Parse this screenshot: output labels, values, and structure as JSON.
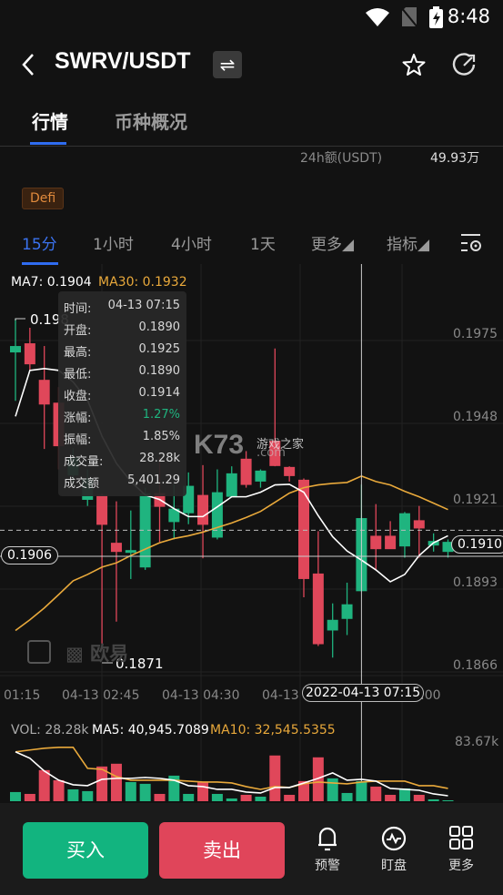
{
  "status": {
    "time": "8:48",
    "icons": [
      "wifi-icon",
      "no-sim-icon",
      "battery-charging-icon"
    ]
  },
  "header": {
    "pair": "SWRV/USDT",
    "back_icon": "chevron-left-icon",
    "swap_icon": "swap-arrows-icon",
    "favorite_icon": "star-icon",
    "share_icon": "refresh-icon"
  },
  "tabs": [
    {
      "label": "行情",
      "active": true
    },
    {
      "label": "币种概况",
      "active": false
    }
  ],
  "stats": {
    "label": "24h额(USDT)",
    "value": "49.93万"
  },
  "tag": "Defi",
  "timeframes": [
    {
      "label": "15分",
      "active": true
    },
    {
      "label": "1小时"
    },
    {
      "label": "4小时"
    },
    {
      "label": "1天"
    },
    {
      "label": "更多◢"
    },
    {
      "label": "指标◢"
    }
  ],
  "colors": {
    "up": "#1fb47f",
    "down": "#e0475a",
    "ma7": "#ffffff",
    "ma30": "#e9a93b",
    "accent": "#2f6cf0"
  },
  "indicators": {
    "ma7": "MA7: 0.1904",
    "ma30": "MA30: 0.1932"
  },
  "tooltip": {
    "rows": [
      {
        "k": "时间:",
        "v": "04-13 07:15"
      },
      {
        "k": "开盘:",
        "v": "0.1890"
      },
      {
        "k": "最高:",
        "v": "0.1925"
      },
      {
        "k": "最低:",
        "v": "0.1890"
      },
      {
        "k": "收盘:",
        "v": "0.1914"
      },
      {
        "k": "涨幅:",
        "v": "1.27%",
        "up": true
      },
      {
        "k": "振幅:",
        "v": "1.85%"
      },
      {
        "k": "成交量:",
        "v": "28.28k"
      },
      {
        "k": "成交额",
        "v": "5,401.29"
      }
    ]
  },
  "markers": {
    "high": "0.198",
    "low": "0.1871",
    "crosshair_price": "0.1906",
    "last_price": "0.1910",
    "crosshair_time": "2022-04-13 07:15"
  },
  "watermark": {
    "brand": "欧易",
    "site": "K73",
    "site_cn": "游戏之家",
    "site_domain": ".com"
  },
  "chart_data": {
    "type": "candlestick",
    "y_ticks": [
      "0.1975",
      "0.1948",
      "0.1921",
      "0.1893",
      "0.1866"
    ],
    "x_ticks": [
      "01:15",
      "04-13 02:45",
      "04-13 04:30",
      "04-13",
      ":00"
    ],
    "candles": [
      [
        0.19684,
        0.19795,
        0.19525,
        0.19705
      ],
      [
        0.19714,
        0.19765,
        0.19624,
        0.19645
      ],
      [
        0.19594,
        0.19705,
        0.19367,
        0.19513
      ],
      [
        0.19519,
        0.1957,
        0.193,
        0.19376
      ],
      [
        0.1928,
        0.1937,
        0.1925,
        0.1934
      ],
      [
        0.192,
        0.193,
        0.1918,
        0.1927
      ],
      [
        0.19216,
        0.1922,
        0.1871,
        0.19118
      ],
      [
        0.19059,
        0.19195,
        0.188,
        0.19029
      ],
      [
        0.19026,
        0.19165,
        0.1894,
        0.19035
      ],
      [
        0.18978,
        0.1924,
        0.1897,
        0.19222
      ],
      [
        0.19222,
        0.1934,
        0.19062,
        0.19177
      ],
      [
        0.19127,
        0.1925,
        0.1907,
        0.19171
      ],
      [
        0.19156,
        0.1929,
        0.1912,
        0.19246
      ],
      [
        0.19216,
        0.19314,
        0.19008,
        0.19118
      ],
      [
        0.19076,
        0.193,
        0.1907,
        0.19225
      ],
      [
        0.1921,
        0.1931,
        0.1921,
        0.19287
      ],
      [
        0.19335,
        0.1936,
        0.1924,
        0.19249
      ],
      [
        0.1926,
        0.193,
        0.1924,
        0.19296
      ],
      [
        0.19394,
        0.19697,
        0.1931,
        0.19311
      ],
      [
        0.19308,
        0.1931,
        0.1926,
        0.19278
      ],
      [
        0.19266,
        0.1927,
        0.1888,
        0.1894
      ],
      [
        0.18958,
        0.19097,
        0.1872,
        0.18726
      ],
      [
        0.18771,
        0.1886,
        0.18682,
        0.18806
      ],
      [
        0.18809,
        0.18928,
        0.18756,
        0.18857
      ],
      [
        0.189,
        0.1925,
        0.189,
        0.1914
      ],
      [
        0.19082,
        0.19186,
        0.18972,
        0.19038
      ],
      [
        0.19082,
        0.1913,
        0.1904,
        0.19038
      ],
      [
        0.19047,
        0.1916,
        0.1901,
        0.19156
      ],
      [
        0.19133,
        0.1918,
        0.1901,
        0.19106
      ],
      [
        0.1905,
        0.1909,
        0.1903,
        0.19065
      ],
      [
        0.19029,
        0.1907,
        0.1901,
        0.19062
      ]
    ],
    "ma7": [
      0.19474,
      0.19625,
      0.19631,
      0.19625,
      0.19587,
      0.19527,
      0.19409,
      0.1932,
      0.1926,
      0.19216,
      0.19201,
      0.19171,
      0.19145,
      0.19145,
      0.19177,
      0.1921,
      0.1921,
      0.19225,
      0.19249,
      0.19251,
      0.19225,
      0.19148,
      0.19079,
      0.19032,
      0.19002,
      0.1897,
      0.18931,
      0.18955,
      0.19017,
      0.19059,
      0.19082
    ],
    "ma30": [
      0.18771,
      0.18806,
      0.18845,
      0.18889,
      0.18934,
      0.18955,
      0.18979,
      0.18993,
      0.19017,
      0.19038,
      0.19059,
      0.19073,
      0.19082,
      0.19094,
      0.19109,
      0.19124,
      0.19142,
      0.19162,
      0.19192,
      0.19222,
      0.1924,
      0.19249,
      0.19254,
      0.19257,
      0.19278,
      0.1926,
      0.19249,
      0.19228,
      0.1921,
      0.19189,
      0.19168
    ],
    "volume": {
      "labels": {
        "vol": "VOL: 28.28k",
        "ma5": "MA5: 40,945.7089",
        "ma10": "MA10: 32,545.5355",
        "max": "83.67k"
      },
      "values_k": [
        12.9,
        10.3,
        43.8,
        29.6,
        16.7,
        14.2,
        48.9,
        52.8,
        27,
        24.5,
        10.3,
        36,
        10.3,
        27,
        10.3,
        3.9,
        9,
        6.4,
        64.4,
        9,
        28.3,
        61.8,
        32.2,
        11.6,
        28.28,
        20.6,
        9,
        18,
        9,
        2.6,
        1.3
      ],
      "ma5_k": [
        69.5,
        60.5,
        42.5,
        29.6,
        23.2,
        21.9,
        30.9,
        32.2,
        32.2,
        33.5,
        32.2,
        29.6,
        21.9,
        20.6,
        16.7,
        16.7,
        12.9,
        11.6,
        19.3,
        19.3,
        25.7,
        32.2,
        39.9,
        29.6,
        30.9,
        28.3,
        18,
        16.7,
        15.4,
        10.3,
        7.7
      ],
      "ma10_k": [
        69.5,
        72.1,
        74.6,
        75.9,
        75.9,
        46.3,
        45,
        34.7,
        29.6,
        29.6,
        29.6,
        29.6,
        28.3,
        27,
        27,
        25.7,
        20.6,
        16.7,
        20.6,
        19.3,
        24.5,
        27,
        25.7,
        24.5,
        27,
        28.3,
        28.3,
        28.3,
        21.9,
        21.9,
        18
      ]
    },
    "ylim": [
      0.1866,
      0.1975
    ],
    "grid": true,
    "selected_index": 24,
    "current_price": 0.191,
    "crosshair_price": 0.1906
  },
  "bottom": {
    "buy": "买入",
    "sell": "卖出",
    "alert": "预警",
    "watch": "盯盘",
    "more": "更多"
  }
}
